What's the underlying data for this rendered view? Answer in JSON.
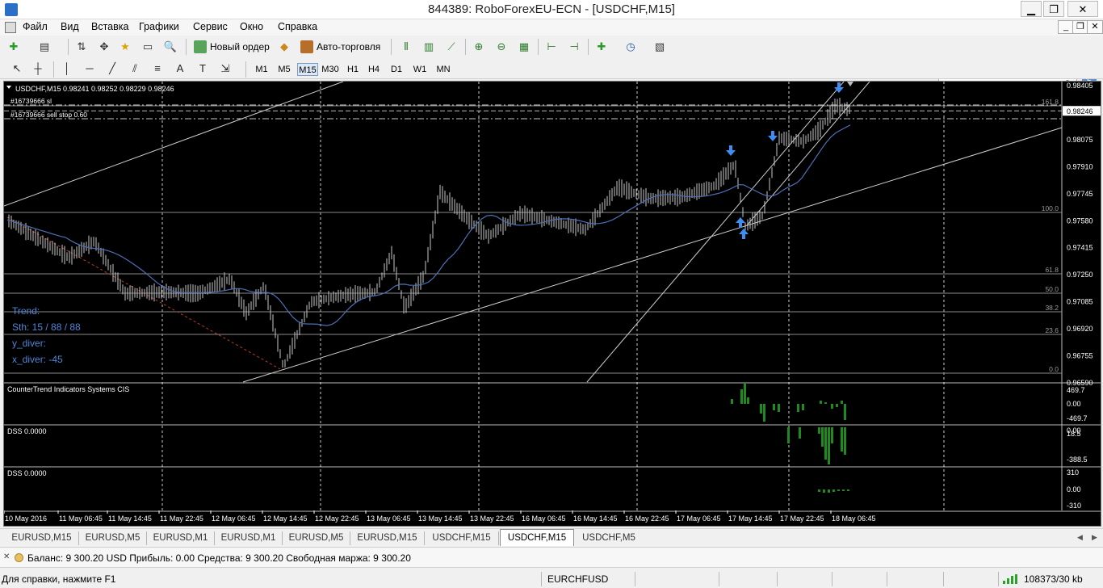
{
  "window": {
    "title": "844389: RoboForexEU-ECN - [USDCHF,M15]",
    "controls": {
      "minimize": "▁",
      "maximize": "❐",
      "close": "✕"
    }
  },
  "menu": {
    "items": [
      "Файл",
      "Вид",
      "Вставка",
      "Графики",
      "Сервис",
      "Окно",
      "Справка"
    ],
    "mdi_controls": {
      "minimize": "_",
      "restore": "❐",
      "close": "✕"
    }
  },
  "toolbar": {
    "new_order_label": "Новый ордер",
    "auto_trading_label": "Авто-торговля",
    "search_placeholder": "",
    "community_badge": "5"
  },
  "timeframes": [
    "M1",
    "M5",
    "M15",
    "M30",
    "H1",
    "H4",
    "D1",
    "W1",
    "MN"
  ],
  "active_timeframe": "M15",
  "chart": {
    "header": "USDCHF,M15  0.98241 0.98252 0.98229 0.98246",
    "order_labels": [
      "#16739666 sl",
      "#16739666 sell stop 0.60"
    ],
    "info_text": [
      "Trend:",
      "Sth: 15 / 88 / 88",
      "y_diver:",
      "x_diver: -45"
    ],
    "price_axis": [
      "0.98405",
      "0.98246",
      "0.98075",
      "0.97910",
      "0.97745",
      "0.97580",
      "0.97415",
      "0.97250",
      "0.97085",
      "0.96920",
      "0.96755",
      "0.96590"
    ],
    "current_price": "0.98246",
    "fib_levels": [
      "161.8",
      "100.0",
      "61.8",
      "50.0",
      "38.2",
      "23.6",
      "0.0"
    ],
    "time_axis": [
      "10 May 2016",
      "11 May 06:45",
      "11 May 14:45",
      "11 May 22:45",
      "12 May 06:45",
      "12 May 14:45",
      "12 May 22:45",
      "13 May 06:45",
      "13 May 14:45",
      "13 May 22:45",
      "16 May 06:45",
      "16 May 14:45",
      "16 May 22:45",
      "17 May 06:45",
      "17 May 14:45",
      "17 May 22:45",
      "18 May 06:45"
    ],
    "sub_panels": [
      {
        "name": "CounterTrend Indicators Systems CIS",
        "axis": [
          "469.7",
          "0.00",
          "-469.7"
        ]
      },
      {
        "name": "DSS 0.0000",
        "axis": [
          "0.00",
          "18.5",
          "-388.5"
        ]
      },
      {
        "name": "DSS 0.0000",
        "axis": [
          "310",
          "0.00",
          "-310"
        ]
      }
    ],
    "colors": {
      "background": "#000000",
      "candles": "#c8c8c8",
      "grid": "#ffffff",
      "moving_average": "#4f6fb4",
      "info_text": "#4f86d8",
      "arrows": "#3d8ef0",
      "histogram": "#1f8a1f",
      "trend_line_red": "#c0392b"
    }
  },
  "tabs": [
    "EURUSD,M15",
    "EURUSD,M5",
    "EURUSD,M1",
    "EURUSD,M1",
    "EURUSD,M5",
    "EURUSD,M15",
    "USDCHF,M15",
    "USDCHF,M15",
    "USDCHF,M5"
  ],
  "active_tab": 7,
  "terminal": {
    "balance_line": "Баланс: 9 300.20 USD  Прибыль: 0.00  Средства: 9 300.20  Свободная маржа: 9 300.20"
  },
  "status": {
    "help": "Для справки, нажмите F1",
    "profile": "EURCHFUSD",
    "traffic": "108373/30 kb"
  }
}
